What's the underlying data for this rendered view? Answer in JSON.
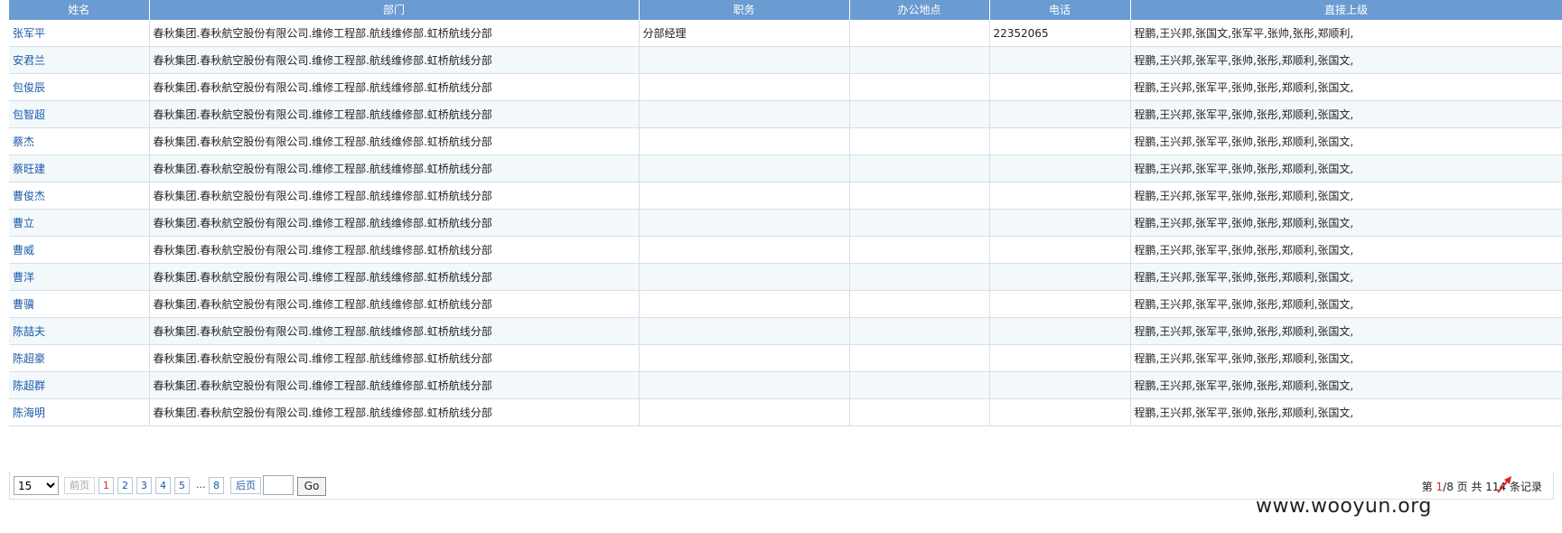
{
  "table": {
    "columns": [
      "姓名",
      "部门",
      "职务",
      "办公地点",
      "电话",
      "直接上级"
    ],
    "rows": [
      {
        "name": "张军平",
        "dept": "春秋集团.春秋航空股份有限公司.维修工程部.航线维修部.虹桥航线分部",
        "title": "分部经理",
        "office": "",
        "phone": "22352065",
        "superior": "程鹏,王兴邦,张国文,张军平,张帅,张彤,郑顺利,"
      },
      {
        "name": "安君兰",
        "dept": "春秋集团.春秋航空股份有限公司.维修工程部.航线维修部.虹桥航线分部",
        "title": "",
        "office": "",
        "phone": "",
        "superior": "程鹏,王兴邦,张军平,张帅,张彤,郑顺利,张国文,"
      },
      {
        "name": "包俊辰",
        "dept": "春秋集团.春秋航空股份有限公司.维修工程部.航线维修部.虹桥航线分部",
        "title": "",
        "office": "",
        "phone": "",
        "superior": "程鹏,王兴邦,张军平,张帅,张彤,郑顺利,张国文,"
      },
      {
        "name": "包智超",
        "dept": "春秋集团.春秋航空股份有限公司.维修工程部.航线维修部.虹桥航线分部",
        "title": "",
        "office": "",
        "phone": "",
        "superior": "程鹏,王兴邦,张军平,张帅,张彤,郑顺利,张国文,"
      },
      {
        "name": "蔡杰",
        "dept": "春秋集团.春秋航空股份有限公司.维修工程部.航线维修部.虹桥航线分部",
        "title": "",
        "office": "",
        "phone": "",
        "superior": "程鹏,王兴邦,张军平,张帅,张彤,郑顺利,张国文,"
      },
      {
        "name": "蔡旺建",
        "dept": "春秋集团.春秋航空股份有限公司.维修工程部.航线维修部.虹桥航线分部",
        "title": "",
        "office": "",
        "phone": "",
        "superior": "程鹏,王兴邦,张军平,张帅,张彤,郑顺利,张国文,"
      },
      {
        "name": "曹俊杰",
        "dept": "春秋集团.春秋航空股份有限公司.维修工程部.航线维修部.虹桥航线分部",
        "title": "",
        "office": "",
        "phone": "",
        "superior": "程鹏,王兴邦,张军平,张帅,张彤,郑顺利,张国文,"
      },
      {
        "name": "曹立",
        "dept": "春秋集团.春秋航空股份有限公司.维修工程部.航线维修部.虹桥航线分部",
        "title": "",
        "office": "",
        "phone": "",
        "superior": "程鹏,王兴邦,张军平,张帅,张彤,郑顺利,张国文,"
      },
      {
        "name": "曹威",
        "dept": "春秋集团.春秋航空股份有限公司.维修工程部.航线维修部.虹桥航线分部",
        "title": "",
        "office": "",
        "phone": "",
        "superior": "程鹏,王兴邦,张军平,张帅,张彤,郑顺利,张国文,"
      },
      {
        "name": "曹洋",
        "dept": "春秋集团.春秋航空股份有限公司.维修工程部.航线维修部.虹桥航线分部",
        "title": "",
        "office": "",
        "phone": "",
        "superior": "程鹏,王兴邦,张军平,张帅,张彤,郑顺利,张国文,"
      },
      {
        "name": "曹骥",
        "dept": "春秋集团.春秋航空股份有限公司.维修工程部.航线维修部.虹桥航线分部",
        "title": "",
        "office": "",
        "phone": "",
        "superior": "程鹏,王兴邦,张军平,张帅,张彤,郑顺利,张国文,"
      },
      {
        "name": "陈喆夫",
        "dept": "春秋集团.春秋航空股份有限公司.维修工程部.航线维修部.虹桥航线分部",
        "title": "",
        "office": "",
        "phone": "",
        "superior": "程鹏,王兴邦,张军平,张帅,张彤,郑顺利,张国文,"
      },
      {
        "name": "陈超豪",
        "dept": "春秋集团.春秋航空股份有限公司.维修工程部.航线维修部.虹桥航线分部",
        "title": "",
        "office": "",
        "phone": "",
        "superior": "程鹏,王兴邦,张军平,张帅,张彤,郑顺利,张国文,"
      },
      {
        "name": "陈超群",
        "dept": "春秋集团.春秋航空股份有限公司.维修工程部.航线维修部.虹桥航线分部",
        "title": "",
        "office": "",
        "phone": "",
        "superior": "程鹏,王兴邦,张军平,张帅,张彤,郑顺利,张国文,"
      },
      {
        "name": "陈海明",
        "dept": "春秋集团.春秋航空股份有限公司.维修工程部.航线维修部.虹桥航线分部",
        "title": "",
        "office": "",
        "phone": "",
        "superior": "程鹏,王兴邦,张军平,张帅,张彤,郑顺利,张国文,"
      }
    ]
  },
  "pager": {
    "page_size": "15",
    "page_size_options": [
      "15"
    ],
    "prev_label": "前页",
    "pages": [
      "1",
      "2",
      "3",
      "4",
      "5"
    ],
    "ellipsis": "...",
    "last_page": "8",
    "next_label": "后页",
    "go_label": "Go",
    "info_prefix": "第 ",
    "current_page": "1",
    "info_mid": "/8 页  共 114 条记录"
  },
  "watermark": "www.wooyun.org",
  "colors": {
    "header_bg": "#6a9bd1",
    "link": "#1a5aa8",
    "current_page": "#d22a2a",
    "row_alt": "#f3f8fb",
    "arrow": "#e02020"
  }
}
